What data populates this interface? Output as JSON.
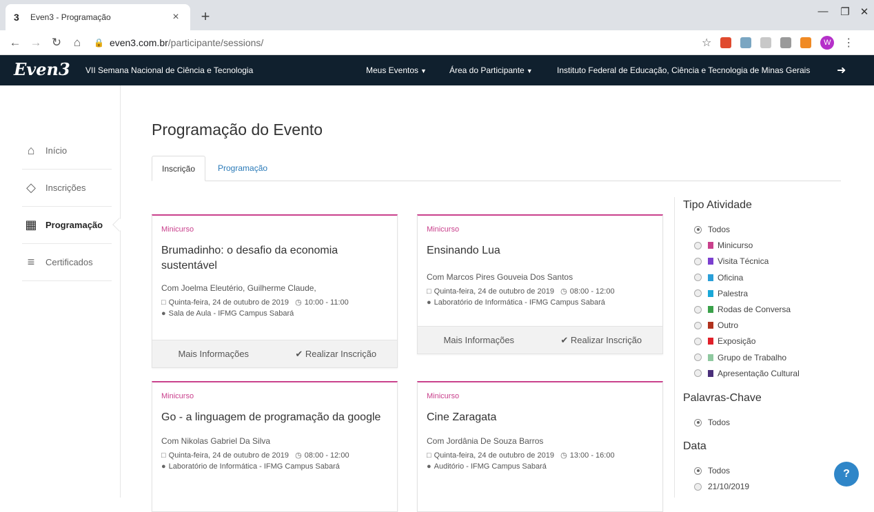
{
  "browser": {
    "tab_favicon": "3",
    "tab_title": "Even3 - Programação",
    "tab_close": "×",
    "new_tab": "+",
    "url_host": "even3.com.br",
    "url_path": "/participante/sessions/",
    "profile_initial": "W"
  },
  "site": {
    "logo": "Even3",
    "event_name": "VII Semana Nacional de Ciência e Tecnologia",
    "nav": {
      "my_events": "Meus Eventos",
      "participant_area": "Área do Participante",
      "institution": "Instituto Federal de Educação, Ciência e Tecnologia de Minas Gerais"
    }
  },
  "sidebar": {
    "items": [
      {
        "label": "Início",
        "icon": "home-icon"
      },
      {
        "label": "Inscrições",
        "icon": "ticket-icon"
      },
      {
        "label": "Programação",
        "icon": "calendar-icon",
        "active": true
      },
      {
        "label": "Certificados",
        "icon": "certificate-icon"
      }
    ]
  },
  "main": {
    "title": "Programação do Evento",
    "tabs": [
      {
        "label": "Inscrição",
        "active": true
      },
      {
        "label": "Programação",
        "active": false
      }
    ],
    "cards": [
      {
        "type": "Minicurso",
        "title": "Brumadinho: o desafio da economia sustentável",
        "speakers": "Com Joelma Eleutério, Guilherme Claude,",
        "date": "Quinta-feira, 24 de outubro de 2019",
        "time": "10:00 - 11:00",
        "location": "Sala de Aula - IFMG Campus Sabará",
        "more": "Mais Informações",
        "enroll": "Realizar Inscrição"
      },
      {
        "type": "Minicurso",
        "title": "Ensinando Lua",
        "speakers": "Com Marcos Pires Gouveia Dos Santos",
        "date": "Quinta-feira, 24 de outubro de 2019",
        "time": "08:00 - 12:00",
        "location": "Laboratório de Informática - IFMG Campus Sabará",
        "more": "Mais Informações",
        "enroll": "Realizar Inscrição"
      },
      {
        "type": "Minicurso",
        "title": "Go - a linguagem de programação da google",
        "speakers": "Com Nikolas Gabriel Da Silva",
        "date": "Quinta-feira, 24 de outubro de 2019",
        "time": "08:00 - 12:00",
        "location": "Laboratório de Informática - IFMG Campus Sabará",
        "more": "Mais Informações",
        "enroll": "Realizar Inscrição"
      },
      {
        "type": "Minicurso",
        "title": "Cine Zaragata",
        "speakers": "Com Jordânia De Souza Barros",
        "date": "Quinta-feira, 24 de outubro de 2019",
        "time": "13:00 - 16:00",
        "location": "Auditório - IFMG Campus Sabará",
        "more": "Mais Informações",
        "enroll": "Realizar Inscrição"
      }
    ]
  },
  "filters": {
    "activity_type": {
      "heading": "Tipo Atividade",
      "options": [
        {
          "label": "Todos",
          "color": "",
          "selected": true
        },
        {
          "label": "Minicurso",
          "color": "#c9408c"
        },
        {
          "label": "Visita Técnica",
          "color": "#7b3fcf"
        },
        {
          "label": "Oficina",
          "color": "#2a9fd8"
        },
        {
          "label": "Palestra",
          "color": "#1aa8d8"
        },
        {
          "label": "Rodas de Conversa",
          "color": "#3aa14a"
        },
        {
          "label": "Outro",
          "color": "#b0321e"
        },
        {
          "label": "Exposição",
          "color": "#e0202a"
        },
        {
          "label": "Grupo de Trabalho",
          "color": "#8fc9a0"
        },
        {
          "label": "Apresentação Cultural",
          "color": "#4a2f7a"
        }
      ]
    },
    "keywords": {
      "heading": "Palavras-Chave",
      "options": [
        {
          "label": "Todos",
          "selected": true
        }
      ]
    },
    "date": {
      "heading": "Data",
      "options": [
        {
          "label": "Todos",
          "selected": true
        },
        {
          "label": "21/10/2019",
          "selected": false
        }
      ]
    }
  },
  "colors": {
    "accent": "#c9408c",
    "navbar": "#10202e",
    "link": "#2a7ab8"
  }
}
